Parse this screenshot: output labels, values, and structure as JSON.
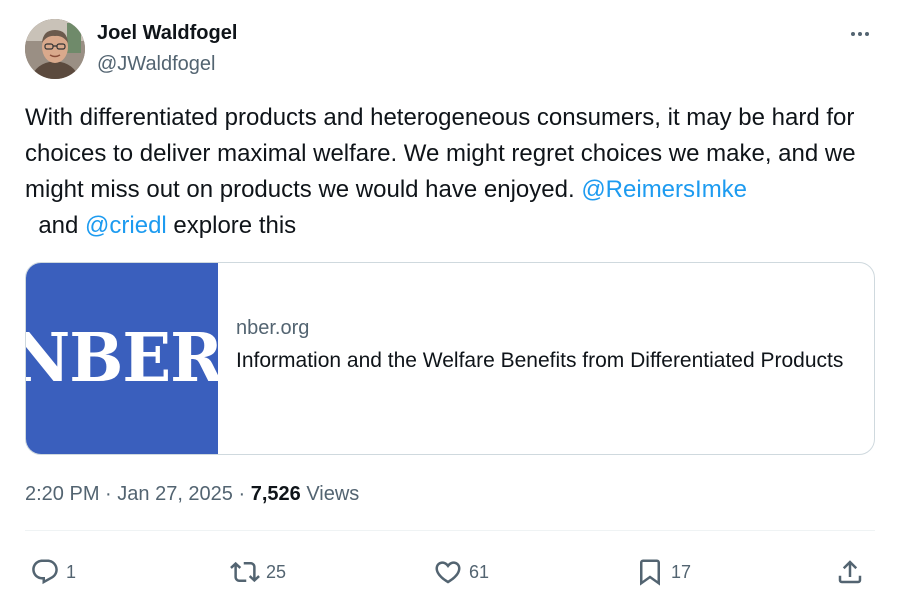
{
  "author": {
    "name": "Joel Waldfogel",
    "handle": "@JWaldfogel"
  },
  "tweet": {
    "text_part1": "With differentiated products and heterogeneous consumers, it may be hard for choices to deliver maximal welfare. We might regret choices we make, and we might miss out on products we would have enjoyed. ",
    "mention1": "@ReimersImke",
    "text_part2": "  and ",
    "mention2": "@criedl",
    "text_part3": " explore this"
  },
  "card": {
    "logo_text": "NBER",
    "domain": "nber.org",
    "title": "Information and the Welfare Benefits from Differentiated Products"
  },
  "meta": {
    "time": "2:20 PM",
    "separator": " · ",
    "date": "Jan 27, 2025",
    "separator2": " · ",
    "views_count": "7,526",
    "views_label": " Views"
  },
  "actions": {
    "reply_count": "1",
    "retweet_count": "25",
    "like_count": "61",
    "bookmark_count": "17"
  },
  "icons": {
    "more": "more-dots-icon",
    "reply": "reply-icon",
    "retweet": "retweet-icon",
    "like": "heart-icon",
    "bookmark": "bookmark-icon",
    "share": "share-icon"
  },
  "colors": {
    "text": "#0f1419",
    "secondary": "#536471",
    "link": "#1d9bf0",
    "card_thumb": "#3a5fbd",
    "border": "#cfd9de"
  }
}
